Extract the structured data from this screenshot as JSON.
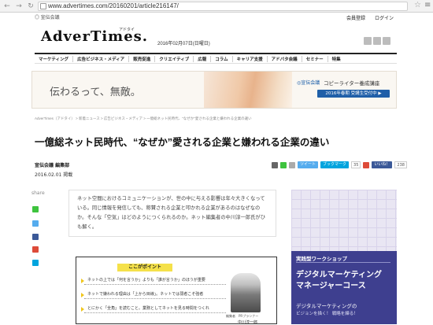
{
  "browser": {
    "back_icon": "back-arrow-icon",
    "forward_icon": "forward-arrow-icon",
    "reload_icon": "reload-icon",
    "url": "www.advertimes.com/20160201/article216147/",
    "bookmark_icon": "star-icon",
    "menu_icon": "hamburger-menu-icon"
  },
  "topbar": {
    "senden_label": "宣伝会議",
    "register_label": "会員登録",
    "login_label": "ログイン"
  },
  "site": {
    "logo": "AdverTimes.",
    "logo_sub": "アドタイ",
    "date": "2016年02月07日(日曜日)"
  },
  "nav": {
    "items": [
      "マーケティング",
      "広告ビジネス・メディア",
      "販売促進",
      "クリエイティブ",
      "広報",
      "コラム",
      "キャリア支援",
      "アドバタ会議",
      "セミナー",
      "特集"
    ]
  },
  "banner": {
    "headline": "伝わるって、無敵。",
    "logo_text": "宣伝会議",
    "course": "コピーライター養成講座",
    "button": "2016年春期 受講生受付中 ▶"
  },
  "article": {
    "breadcrumb": "AdverTimes（アドタイ） > 新着ニュース > 広告ビジネス・メディア > 一億総ネット民時代、\"なぜか\"愛される企業と嫌われる企業の違い",
    "title": "一億総ネット民時代、“なぜか”愛される企業と嫌われる企業の違い",
    "author": "宣伝会議 編集部",
    "published": "2016.02.01 掲載",
    "lead": "ネット空間におけるコミュニケーションが、世の中に与える影響は年々大きくなっている。同じ情報を発信しても、称賛される企業と叩かれる企業があるのはなぜなのか。そんな「空気」はどのようにつくられるのか。ネット編集者の中川淳一郎氏がひも解く。"
  },
  "share_tools": {
    "tweet_label": "ツイート",
    "bookmark_label": "ブックマーク",
    "bookmark_count": "35",
    "like_label": "いいね！",
    "like_count": "238"
  },
  "share": {
    "label": "share"
  },
  "points": {
    "heading": "ここがポイント",
    "items": [
      "ネットの上では「何を言うか」よりも「誰が言うか」のほうが重要",
      "ネットで嫌われる理由は「上から目線」。ネットでは弱者こそ強者",
      "とにかく「全角」を読むこと。業務としてネットを見る時間をつくれ"
    ],
    "editor_role": "編集者　PRプランナー",
    "editor_name": "中川淳一郎"
  },
  "side_ad": {
    "tag": "実践型ワークショップ",
    "title_line1": "デジタルマーケティング",
    "title_line2": "マネージャーコース",
    "sub_line1": "デジタルマーケティングの",
    "sub_line2": "ビジョンを描く！ 戦略を練る！"
  },
  "colors": {
    "accent_blue": "#1f5fa8",
    "twitter": "#55acee",
    "facebook": "#3b5998",
    "hatena": "#00a4de",
    "line": "#3ec33e",
    "gplus": "#dd4b39",
    "ad_purple": "#3e3f8f",
    "highlight_yellow": "#f5e14a"
  }
}
